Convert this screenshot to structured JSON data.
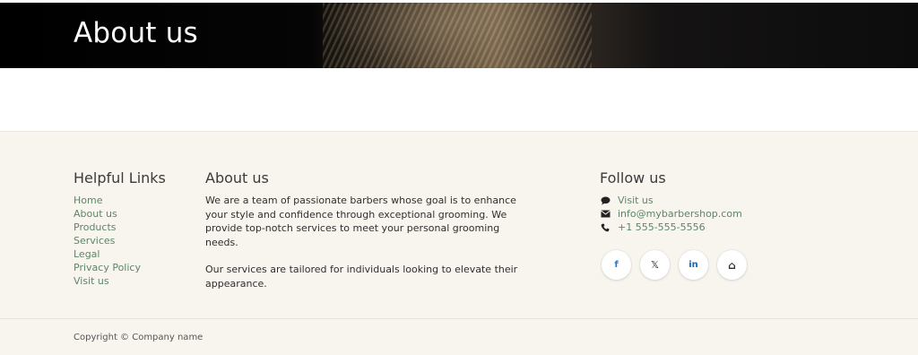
{
  "hero": {
    "title": "About us"
  },
  "footer": {
    "helpful_links": {
      "heading": "Helpful Links",
      "items": [
        "Home",
        "About us",
        "Products",
        "Services",
        "Legal",
        "Privacy Policy",
        "Visit us"
      ]
    },
    "about": {
      "heading": "About us",
      "paragraph1": "We are a team of passionate barbers whose goal is to enhance your style and confidence through exceptional grooming. We provide top-notch services to meet your personal grooming needs.",
      "paragraph2": "Our services are tailored for individuals looking to elevate their appearance."
    },
    "follow": {
      "heading": "Follow us",
      "visit": "Visit us",
      "email": "info@mybarbershop.com",
      "phone": "+1 555-555-5556",
      "socials": [
        {
          "icon": "facebook-icon",
          "glyph": "f",
          "color": "#1877f2"
        },
        {
          "icon": "x-icon",
          "glyph": "𝕏",
          "color": "#222222"
        },
        {
          "icon": "linkedin-icon",
          "glyph": "in",
          "color": "#0a66c2"
        },
        {
          "icon": "home-icon",
          "glyph": "⌂",
          "color": "#333333"
        }
      ]
    },
    "copyright": "Copyright © Company name"
  },
  "colors": {
    "link": "#5d8567",
    "footer_bg": "#f8f5ef"
  }
}
